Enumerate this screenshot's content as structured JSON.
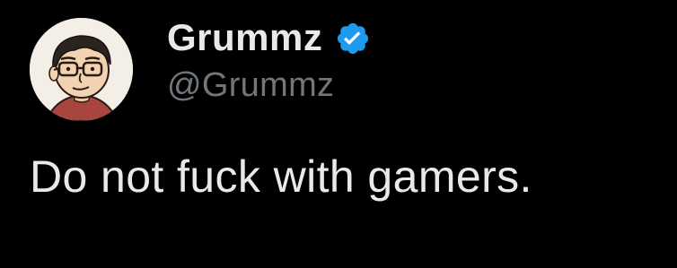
{
  "author": {
    "display_name": "Grummz",
    "handle": "@Grummz",
    "verified": true,
    "avatar_icon": "cartoon-face-avatar-icon",
    "badge_icon": "verified-badge-icon"
  },
  "tweet": {
    "text": "Do not fuck with gamers."
  },
  "colors": {
    "background": "#000000",
    "primary_text": "#e7e9ea",
    "secondary_text": "#71767b",
    "verified_blue": "#1d9bf0"
  }
}
